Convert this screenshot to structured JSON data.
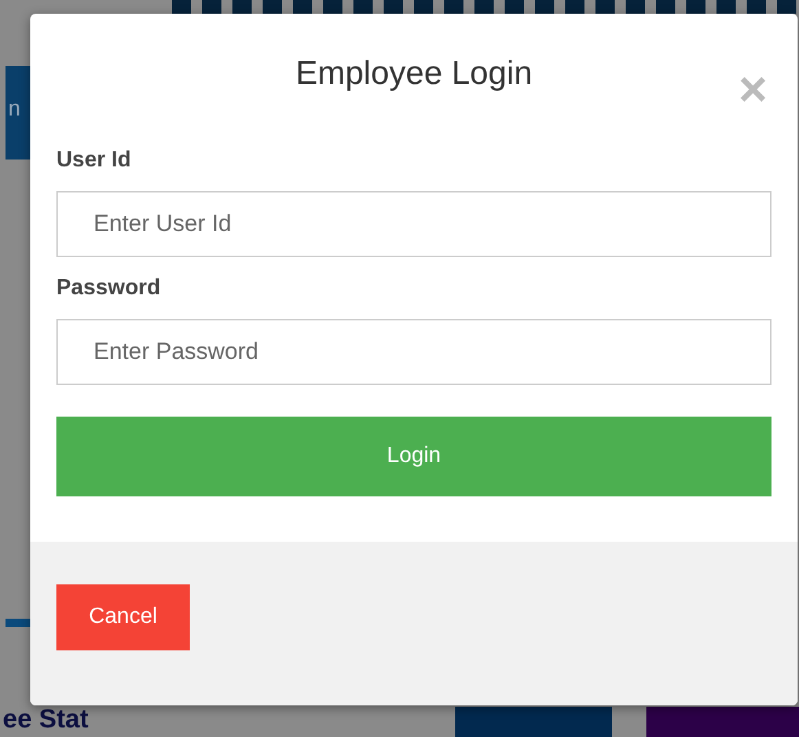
{
  "background": {
    "side_button": "n",
    "section_title": "ee Stat"
  },
  "dialog": {
    "title": "Employee Login",
    "close": "×",
    "fields": [
      {
        "label": "User Id",
        "placeholder": "Enter User Id"
      },
      {
        "label": "Password",
        "placeholder": "Enter Password"
      }
    ],
    "login_button": "Login",
    "cancel_button": "Cancel"
  }
}
